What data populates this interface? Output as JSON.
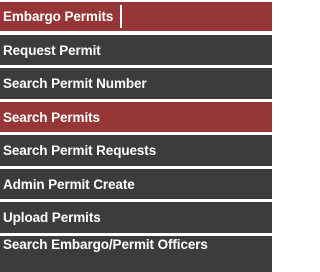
{
  "menu": {
    "items": [
      {
        "label": "Embargo Permits",
        "state": "header"
      },
      {
        "label": "Request Permit",
        "state": "normal"
      },
      {
        "label": "Search Permit Number",
        "state": "normal"
      },
      {
        "label": "Search Permits",
        "state": "selected"
      },
      {
        "label": "Search Permit Requests",
        "state": "normal"
      },
      {
        "label": "Admin Permit Create",
        "state": "normal"
      },
      {
        "label": "Upload Permits",
        "state": "normal"
      },
      {
        "label": "Search Embargo/Permit Officers",
        "state": "normal"
      }
    ]
  },
  "colors": {
    "header_bg": "#973636",
    "item_bg": "#3c3c3c",
    "selected_bg": "#973636",
    "text": "#ffffff"
  }
}
